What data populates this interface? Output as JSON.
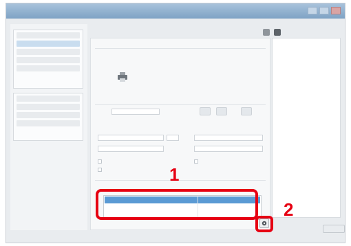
{
  "callouts": {
    "step1": "1",
    "step2": "2"
  },
  "colors": {
    "callout": "#e60012",
    "selection": "#5a9ad4",
    "titlebar": "#7ea2c4"
  },
  "icons": {
    "printer": "printer-icon",
    "gear": "gear-icon"
  }
}
